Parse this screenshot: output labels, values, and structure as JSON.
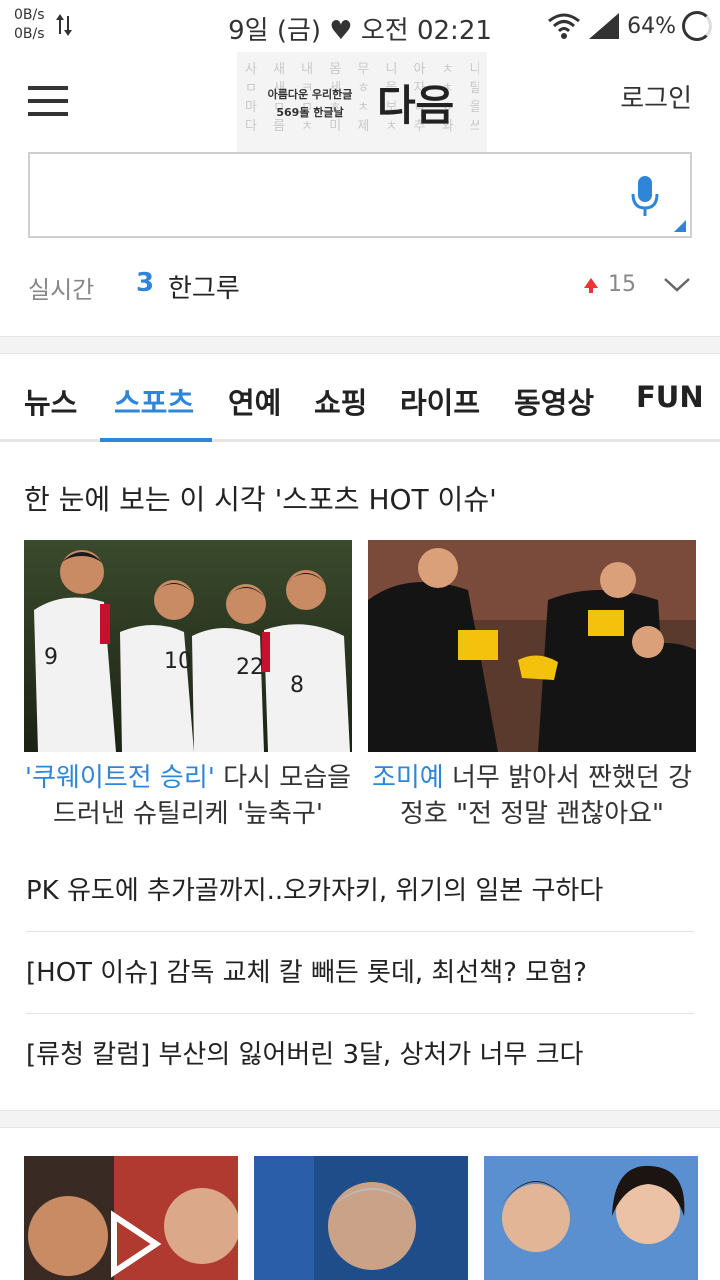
{
  "status_bar": {
    "net_up": "0B/s",
    "net_down": "0B/s",
    "datetime": "9일 (금) ♥ 오전 02:21",
    "battery": "64%"
  },
  "header": {
    "logo_grid": [
      "사 새 내 몸 무 니 아 ㅊ 나",
      "ㅁ 새 ㅋ 세 ㅎ 을 자 ㅊ 탈",
      "마 ㅁ ㅁ ㅎ ㅊ 보 ㅁ ㅎ 을",
      "다 름 ㅊ 미 제 ㅊ 추 와 쓰"
    ],
    "logo_small_1": "아름다운 우리한글",
    "logo_small_2": "569돌 한글날",
    "logo_main": "다음",
    "login_label": "로그인"
  },
  "search": {
    "value": "",
    "placeholder": ""
  },
  "realtime": {
    "label": "실시간",
    "rank": "3",
    "keyword": "한그루",
    "change": "15"
  },
  "tabs": [
    "뉴스",
    "스포츠",
    "연예",
    "쇼핑",
    "라이프",
    "동영상",
    "FUN"
  ],
  "section": {
    "title": "한 눈에 보는 이 시각 '스포츠 HOT 이슈'"
  },
  "cards": [
    {
      "highlight": "'쿠웨이트전 승리'",
      "text_1": " 다시 모습을",
      "text_2": "드러낸 슈틸리케 '늪축구'",
      "jerseys": [
        "9",
        "10",
        "22",
        "8"
      ]
    },
    {
      "highlight": "조미예",
      "text_1": " 너무 밝아서 짠했던 강",
      "text_2": "정호 \"전 정말 괜찮아요\""
    }
  ],
  "headlines": [
    "PK 유도에 추가골까지..오카자키, 위기의 일본 구하다",
    "[HOT 이슈] 감독 교체 칼 빼든 롯데, 최선책? 모험?",
    "[류청 칼럼] 부산의 잃어버린 3달, 상처가 너무 크다"
  ],
  "colors": {
    "accent": "#2f86d8",
    "up": "#e33333"
  }
}
